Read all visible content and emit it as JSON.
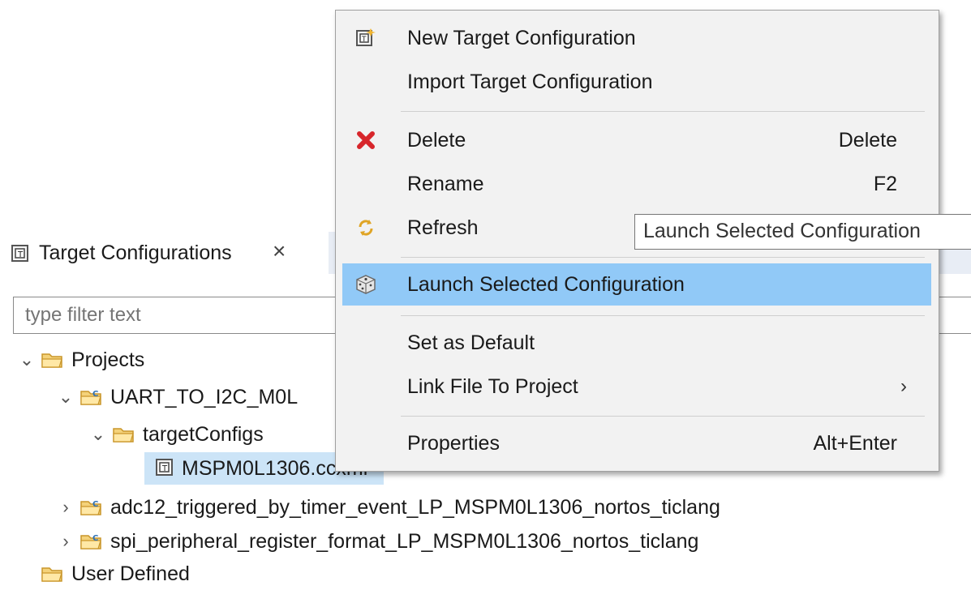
{
  "view": {
    "title": "Target Configurations",
    "close_glyph": "×",
    "filter_placeholder": "type filter text"
  },
  "tree": {
    "projects": "Projects",
    "project1": "UART_TO_I2C_M0L",
    "target_configs": "targetConfigs",
    "file": "MSPM0L1306.ccxml",
    "project2": "adc12_triggered_by_timer_event_LP_MSPM0L1306_nortos_ticlang",
    "project3": "spi_peripheral_register_format_LP_MSPM0L1306_nortos_ticlang",
    "user_defined": "User Defined"
  },
  "menu": {
    "new_target": "New Target Configuration",
    "import_target": "Import Target Configuration",
    "delete": "Delete",
    "delete_accel": "Delete",
    "rename": "Rename",
    "rename_accel": "F2",
    "refresh": "Refresh",
    "launch": "Launch Selected Configuration",
    "set_default": "Set as Default",
    "link_file": "Link File To Project",
    "properties": "Properties",
    "properties_accel": "Alt+Enter"
  },
  "tooltip": "Launch Selected Configuration",
  "colors": {
    "menu_bg": "#f2f2f2",
    "hover": "#91c9f7",
    "selected_row": "#cce4f7",
    "folder": "#e8b648",
    "delete_red": "#d7262b"
  },
  "icons": {
    "target": "target-config-icon",
    "folder": "folder-icon",
    "project": "project-folder-icon",
    "delete": "red-x-icon",
    "refresh": "refresh-icon",
    "launch": "launch-die-icon"
  }
}
